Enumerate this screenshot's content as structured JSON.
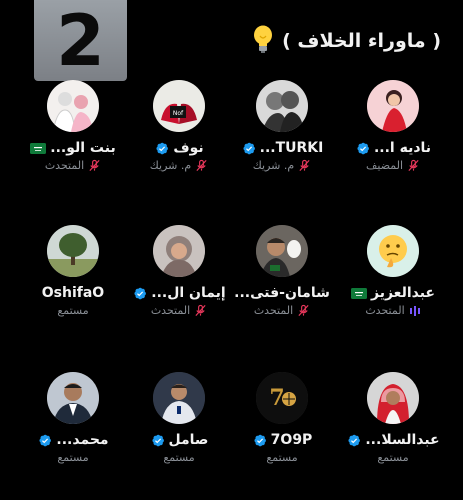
{
  "overlay_number": "2",
  "space": {
    "title": "( ماوراء الخلاف )"
  },
  "participants": [
    {
      "name": "ناديه ا...",
      "verified": true,
      "role": "المضيف",
      "mic": "off",
      "avatar": "avatar-illustrated-woman-red"
    },
    {
      "name": "TURKI...",
      "verified": true,
      "role": "م. شريك",
      "mic": "off",
      "avatar": "avatar-two-men-grayscale"
    },
    {
      "name": "نوف",
      "verified": true,
      "role": "م. شريك",
      "mic": "off",
      "avatar": "avatar-red-hands-holding-card"
    },
    {
      "name": "بنت الو...",
      "verified": false,
      "flag": "saudi",
      "role": "المتحدث",
      "mic": "off",
      "avatar": "avatar-family-photo"
    },
    {
      "name": "عبدالعزيز",
      "verified": false,
      "flag": "saudi",
      "role": "المتحدث",
      "mic": "speaking",
      "avatar": "avatar-thinking-emoji"
    },
    {
      "name": "شامان-فتى...",
      "verified": false,
      "role": "المتحدث",
      "mic": "off",
      "avatar": "avatar-man-with-bird"
    },
    {
      "name": "إيمان ال...",
      "verified": true,
      "role": "المتحدث",
      "mic": "off",
      "avatar": "avatar-woman-hijab"
    },
    {
      "name": "OshifaO",
      "verified": false,
      "role": "مستمع",
      "mic": "none",
      "avatar": "avatar-tree-landscape"
    },
    {
      "name": "عبدالسلا...",
      "verified": true,
      "role": "مستمع",
      "mic": "none",
      "avatar": "avatar-man-in-shemagh"
    },
    {
      "name": "7O9P",
      "verified": true,
      "role": "مستمع",
      "mic": "none",
      "avatar": "avatar-gold-70-logo"
    },
    {
      "name": "صامل",
      "verified": true,
      "role": "مستمع",
      "mic": "none",
      "avatar": "avatar-footballer"
    },
    {
      "name": "محمد...",
      "verified": true,
      "role": "مستمع",
      "mic": "none",
      "avatar": "avatar-man-in-suit"
    }
  ],
  "colors": {
    "verified": "#1d9bf0",
    "mic_off": "#e8375b",
    "speaking": "#7856ff",
    "role_text": "#8b9097"
  }
}
